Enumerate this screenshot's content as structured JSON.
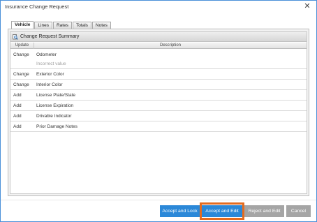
{
  "window": {
    "title": "Insurance Change Request",
    "close_glyph": "✕"
  },
  "tabs": [
    {
      "label": "Vehicle",
      "active": true
    },
    {
      "label": "Lines",
      "active": false
    },
    {
      "label": "Rates",
      "active": false
    },
    {
      "label": "Totals",
      "active": false
    },
    {
      "label": "Notes",
      "active": false
    }
  ],
  "summary": {
    "title": "Change Request Summary",
    "icon": "magnifier-document-icon"
  },
  "columns": {
    "update": "Update",
    "description": "Description"
  },
  "rows": [
    {
      "update": "Change",
      "description": "Odometer",
      "sub": "Incorrect value"
    },
    {
      "update": "Change",
      "description": "Exterior Color"
    },
    {
      "update": "Change",
      "description": "Interior Color"
    },
    {
      "update": "Add",
      "description": "License Plate/State"
    },
    {
      "update": "Add",
      "description": "License Expiration"
    },
    {
      "update": "Add",
      "description": "Drivable Indicator"
    },
    {
      "update": "Add",
      "description": "Prior Damage Notes"
    }
  ],
  "buttons": {
    "accept_lock": "Accept and Lock",
    "accept_edit": "Accept and Edit",
    "reject_edit": "Reject and Edit",
    "cancel": "Cancel"
  },
  "colors": {
    "accent": "#2b88d8",
    "disabled": "#a5a5a5",
    "highlight": "#e56b1f",
    "window_border": "#4a90d9"
  }
}
